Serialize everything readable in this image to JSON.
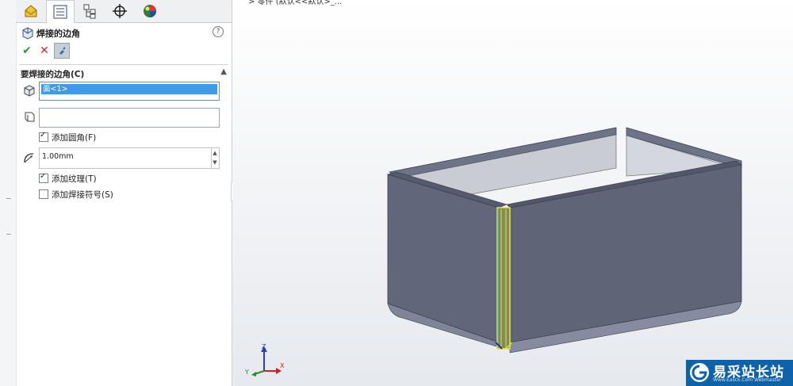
{
  "property_manager": {
    "title": "焊接的边角",
    "help": "?",
    "actions": {
      "ok": "✔",
      "cancel": "✕",
      "pin": "✎"
    },
    "section": {
      "title": "要焊接的边角(C)",
      "faces_selected": "面<1>",
      "second_list": "",
      "add_fillet_label": "添加圆角(F)",
      "add_fillet_checked": true,
      "radius_value": "1.00mm",
      "add_texture_label": "添加纹理(T)",
      "add_texture_checked": true,
      "add_weld_symbol_label": "添加焊接符号(S)",
      "add_weld_symbol_checked": false
    }
  },
  "tabs": [
    "feature-manager",
    "property-manager",
    "configuration-manager",
    "dimxpert-manager",
    "display-manager"
  ],
  "viewport": {
    "breadcrumb": "> 零件 (默认<<默认>_...",
    "triad": {
      "x": "X",
      "y": "Y",
      "z": "Z"
    }
  },
  "watermark": {
    "text": "易采站长站",
    "subtitle": "Www.Easck.Com Webmaster"
  },
  "colors": {
    "selection": "#3d9be9",
    "model_face": "#5f6577",
    "highlight_edge": "#e8e23a",
    "watermark_bg": "#0e62a8"
  }
}
